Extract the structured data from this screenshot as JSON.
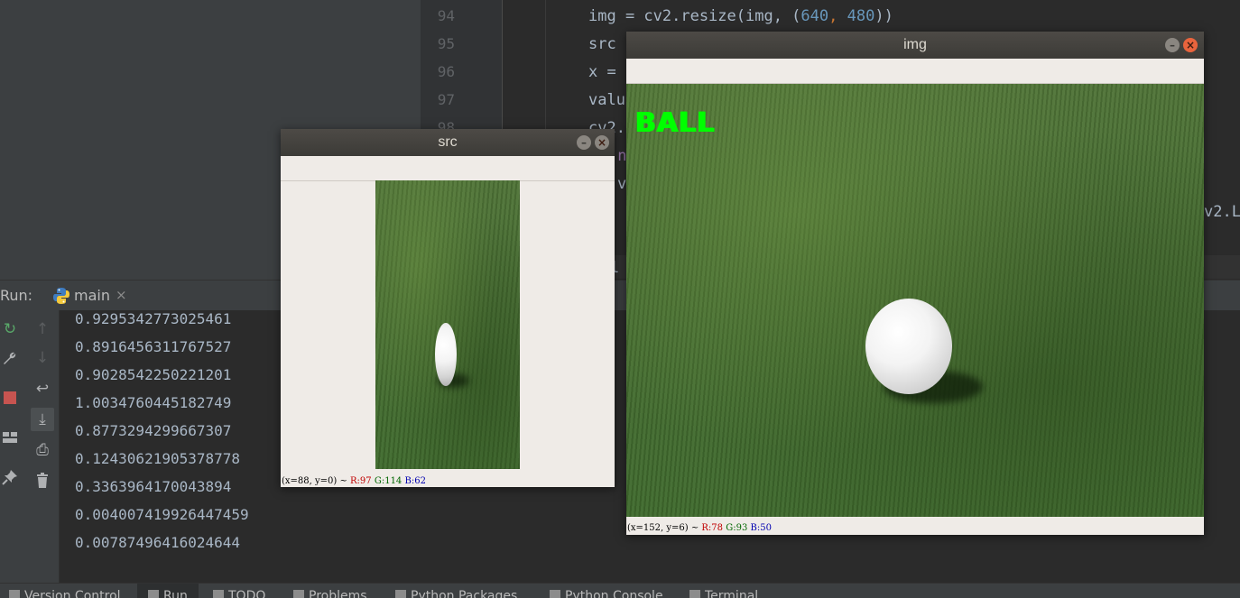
{
  "editor": {
    "line_numbers": [
      "94",
      "95",
      "96",
      "97",
      "98"
    ],
    "code_lines": [
      {
        "pre": "img = cv2.resize(img, (",
        "n1": "640",
        "mid": ", ",
        "n2": "480",
        "post": "))"
      },
      {
        "text": "src"
      },
      {
        "text": "x ="
      },
      {
        "text": "valu"
      },
      {
        "text": "cv2."
      }
    ],
    "fragments": [
      ".n",
      "v",
      "v2.L",
      "l ="
    ]
  },
  "run_panel": {
    "label": "Run:",
    "tab": {
      "label": "main",
      "close": "×",
      "icon": "python-icon"
    },
    "left_toolbar": [
      {
        "icon": "rerun-icon",
        "glyph": "↻",
        "color": "#59a869"
      },
      {
        "icon": "wrench-icon",
        "glyph": "🔧",
        "color": "#afb1b3"
      },
      {
        "icon": "stop-icon",
        "glyph": "■",
        "color": "#c75450"
      },
      {
        "icon": "layout-icon",
        "glyph": "▤",
        "color": "#afb1b3"
      },
      {
        "icon": "pin-icon",
        "glyph": "📌",
        "color": "#afb1b3"
      }
    ],
    "second_toolbar": [
      {
        "icon": "up-arrow-icon",
        "glyph": "↑"
      },
      {
        "icon": "down-arrow-icon",
        "glyph": "↓"
      },
      {
        "icon": "soft-wrap-icon",
        "glyph": "↩"
      },
      {
        "icon": "scroll-to-end-icon",
        "glyph": "⤓"
      },
      {
        "icon": "print-icon",
        "glyph": "⎙"
      },
      {
        "icon": "trash-icon",
        "glyph": "🗑"
      }
    ],
    "output_lines": [
      "0.9295342773025461",
      "0.891645631176752​7",
      "0.9028542250221201",
      "1.0034760445182749",
      "0.8773294299667307",
      "0.12430621905378778",
      "0.3363964170043894",
      "0.004007419926447459",
      "0.00787496416024644"
    ]
  },
  "bottom_tabs": [
    {
      "label": "Version Control",
      "icon": "version-control-icon"
    },
    {
      "label": "Run",
      "icon": "run-icon"
    },
    {
      "label": "TODO",
      "icon": "todo-icon"
    },
    {
      "label": "Problems",
      "icon": "problems-icon"
    },
    {
      "label": "Python Packages",
      "icon": "packages-icon"
    },
    {
      "label": "Python Console",
      "icon": "console-icon"
    },
    {
      "label": "Terminal",
      "icon": "terminal-icon"
    }
  ],
  "src_window": {
    "title": "src",
    "status": {
      "prefix": "(x=88, y=0) ~ ",
      "r": "R:97",
      "g": "G:114",
      "b": "B:62"
    }
  },
  "img_window": {
    "title": "img",
    "label": "BALL",
    "label_color": "#00ff00",
    "status": {
      "prefix": "(x=152, y=6) ~ ",
      "r": "R:78",
      "g": "G:93",
      "b": "B:50"
    }
  }
}
